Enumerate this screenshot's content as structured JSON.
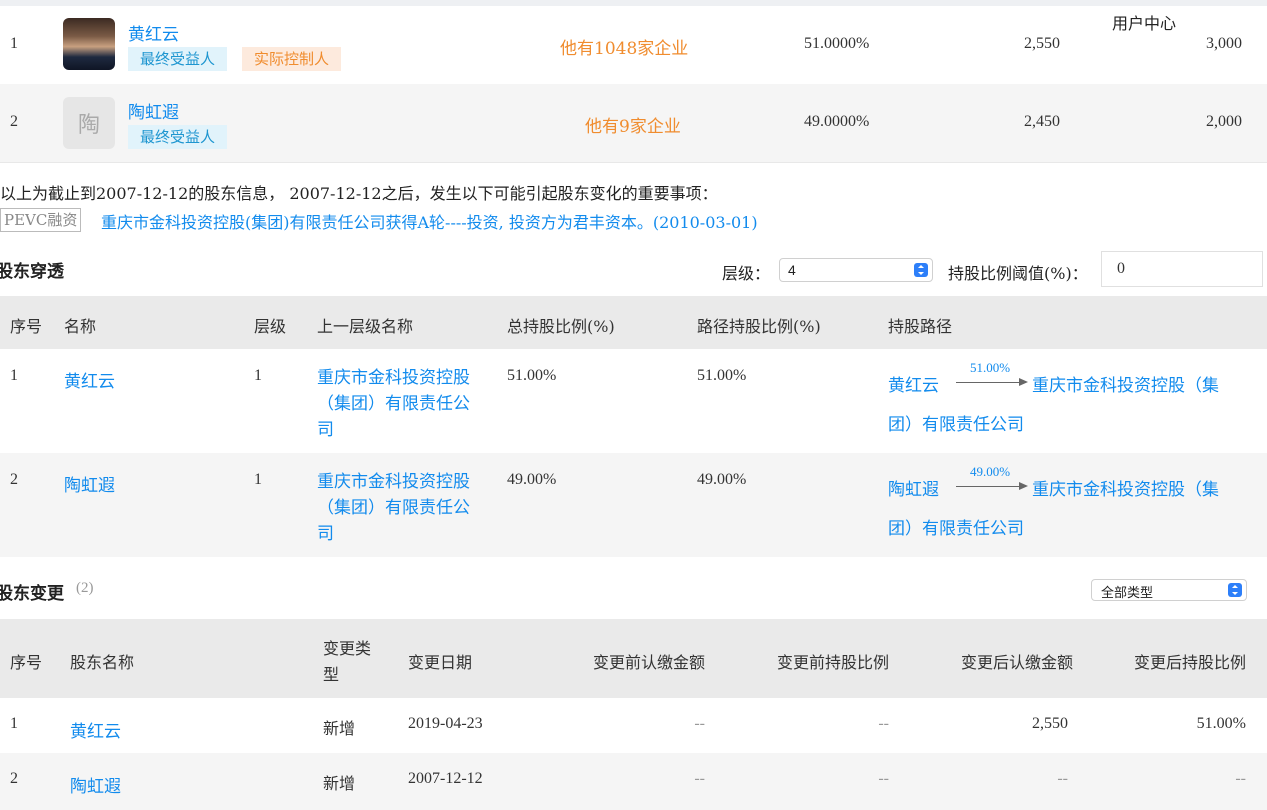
{
  "header_right_label": "用户中心",
  "shareholders": [
    {
      "index": "1",
      "name": "黄红云",
      "tags": [
        "最终受益人",
        "实际控制人"
      ],
      "other_companies": "他有1048家企业",
      "ratio": "51.0000%",
      "amount": "2,550",
      "extra": "3,000",
      "avatar": "photo"
    },
    {
      "index": "2",
      "name": "陶虹遐",
      "tags": [
        "最终受益人"
      ],
      "other_companies": "他有9家企业",
      "ratio": "49.0000%",
      "amount": "2,450",
      "extra": "2,000",
      "avatar": "陶"
    }
  ],
  "notice": {
    "text": "以上为截止到2007-12-12的股东信息， 2007-12-12之后，发生以下可能引起股东变化的重要事项：",
    "tag": "PEVC融资",
    "link": "重庆市金科投资控股(集团)有限责任公司获得A轮----投资, 投资方为君丰资本。(2010-03-01)"
  },
  "penetration": {
    "title": "股东穿透",
    "level_label": "层级：",
    "level_value": "4",
    "threshold_label": "持股比例阈值(%)：",
    "threshold_value": "0",
    "headers": [
      "序号",
      "名称",
      "层级",
      "上一层级名称",
      "总持股比例(%)",
      "路径持股比例(%)",
      "持股路径"
    ],
    "rows": [
      {
        "index": "1",
        "name": "黄红云",
        "level": "1",
        "parent_l1": "重庆市金科投资控股",
        "parent_l2": "（集团）有限责任公",
        "parent_l3": "司",
        "total": "51.00%",
        "path_ratio": "51.00%",
        "path_from": "黄红云",
        "path_pct": "51.00%",
        "path_to_l1": "重庆市金科投资控股（集",
        "path_to_l2": "团）有限责任公司"
      },
      {
        "index": "2",
        "name": "陶虹遐",
        "level": "1",
        "parent_l1": "重庆市金科投资控股",
        "parent_l2": "（集团）有限责任公",
        "parent_l3": "司",
        "total": "49.00%",
        "path_ratio": "49.00%",
        "path_from": "陶虹遐",
        "path_pct": "49.00%",
        "path_to_l1": "重庆市金科投资控股（集",
        "path_to_l2": "团）有限责任公司"
      }
    ]
  },
  "changes": {
    "title": "股东变更",
    "count": "(2)",
    "filter_value": "全部类型",
    "headers": {
      "index": "序号",
      "name": "股东名称",
      "type_l1": "变更类",
      "type_l2": "型",
      "date": "变更日期",
      "before_amount": "变更前认缴金额",
      "before_ratio": "变更前持股比例",
      "after_amount": "变更后认缴金额",
      "after_ratio": "变更后持股比例"
    },
    "rows": [
      {
        "index": "1",
        "name": "黄红云",
        "type": "新增",
        "date": "2019-04-23",
        "before_amount": "--",
        "before_ratio": "--",
        "after_amount": "2,550",
        "after_ratio": "51.00%"
      },
      {
        "index": "2",
        "name": "陶虹遐",
        "type": "新增",
        "date": "2007-12-12",
        "before_amount": "--",
        "before_ratio": "--",
        "after_amount": "--",
        "after_ratio": "--"
      }
    ]
  }
}
